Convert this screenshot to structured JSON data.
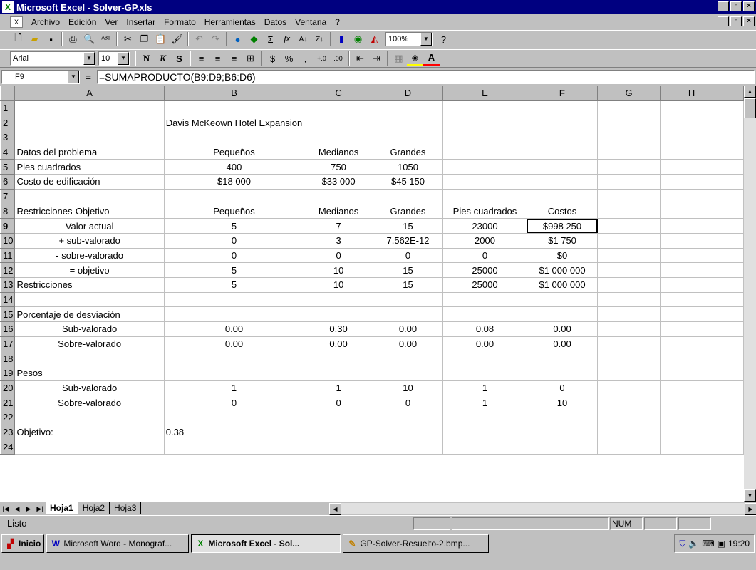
{
  "window": {
    "title": "Microsoft Excel - Solver-GP.xls"
  },
  "menu": [
    "Archivo",
    "Edición",
    "Ver",
    "Insertar",
    "Formato",
    "Herramientas",
    "Datos",
    "Ventana",
    "?"
  ],
  "toolbar": {
    "zoom": "100%",
    "font": "Arial",
    "font_size": "10",
    "bold": "N",
    "italic": "K",
    "underline": "S"
  },
  "formula_bar": {
    "name_box": "F9",
    "equals": "=",
    "formula": "=SUMAPRODUCTO(B9:D9;B6:D6)"
  },
  "sheet": {
    "columns": [
      "A",
      "B",
      "C",
      "D",
      "E",
      "F",
      "G",
      "H"
    ],
    "rows": [
      {
        "n": "1",
        "cells": [
          "",
          "",
          "",
          "",
          "",
          "",
          "",
          ""
        ]
      },
      {
        "n": "2",
        "cells": [
          "",
          "Davis McKeown Hotel Expansion",
          "",
          "",
          "",
          "",
          "",
          ""
        ]
      },
      {
        "n": "3",
        "cells": [
          "",
          "",
          "",
          "",
          "",
          "",
          "",
          ""
        ]
      },
      {
        "n": "4",
        "cells": [
          "Datos del problema",
          "Pequeños",
          "Medianos",
          "Grandes",
          "",
          "",
          "",
          ""
        ]
      },
      {
        "n": "5",
        "cells": [
          "Pies cuadrados",
          "400",
          "750",
          "1050",
          "",
          "",
          "",
          ""
        ]
      },
      {
        "n": "6",
        "cells": [
          "Costo de edificación",
          "$18 000",
          "$33 000",
          "$45 150",
          "",
          "",
          "",
          ""
        ]
      },
      {
        "n": "7",
        "cells": [
          "",
          "",
          "",
          "",
          "",
          "",
          "",
          ""
        ]
      },
      {
        "n": "8",
        "cells": [
          "Restricciones-Objetivo",
          "Pequeños",
          "Medianos",
          "Grandes",
          "Pies cuadrados",
          "Costos",
          "",
          ""
        ]
      },
      {
        "n": "9",
        "cells": [
          "Valor actual",
          "5",
          "7",
          "15",
          "23000",
          "$998 250",
          "",
          ""
        ]
      },
      {
        "n": "10",
        "cells": [
          "+ sub-valorado",
          "0",
          "3",
          "7.562E-12",
          "2000",
          "$1 750",
          "",
          ""
        ]
      },
      {
        "n": "11",
        "cells": [
          "- sobre-valorado",
          "0",
          "0",
          "0",
          "0",
          "$0",
          "",
          ""
        ]
      },
      {
        "n": "12",
        "cells": [
          "= objetivo",
          "5",
          "10",
          "15",
          "25000",
          "$1 000 000",
          "",
          ""
        ]
      },
      {
        "n": "13",
        "cells": [
          "Restricciones",
          "5",
          "10",
          "15",
          "25000",
          "$1 000 000",
          "",
          ""
        ]
      },
      {
        "n": "14",
        "cells": [
          "",
          "",
          "",
          "",
          "",
          "",
          "",
          ""
        ]
      },
      {
        "n": "15",
        "cells": [
          "Porcentaje de desviación",
          "",
          "",
          "",
          "",
          "",
          "",
          ""
        ]
      },
      {
        "n": "16",
        "cells": [
          "Sub-valorado",
          "0.00",
          "0.30",
          "0.00",
          "0.08",
          "0.00",
          "",
          ""
        ]
      },
      {
        "n": "17",
        "cells": [
          "Sobre-valorado",
          "0.00",
          "0.00",
          "0.00",
          "0.00",
          "0.00",
          "",
          ""
        ]
      },
      {
        "n": "18",
        "cells": [
          "",
          "",
          "",
          "",
          "",
          "",
          "",
          ""
        ]
      },
      {
        "n": "19",
        "cells": [
          "Pesos",
          "",
          "",
          "",
          "",
          "",
          "",
          ""
        ]
      },
      {
        "n": "20",
        "cells": [
          "Sub-valorado",
          "1",
          "1",
          "10",
          "1",
          "0",
          "",
          ""
        ]
      },
      {
        "n": "21",
        "cells": [
          "Sobre-valorado",
          "0",
          "0",
          "0",
          "1",
          "10",
          "",
          ""
        ]
      },
      {
        "n": "22",
        "cells": [
          "",
          "",
          "",
          "",
          "",
          "",
          "",
          ""
        ]
      },
      {
        "n": "23",
        "cells": [
          "Objetivo:",
          "0.38",
          "",
          "",
          "",
          "",
          "",
          ""
        ]
      },
      {
        "n": "24",
        "cells": [
          "",
          "",
          "",
          "",
          "",
          "",
          "",
          ""
        ]
      }
    ]
  },
  "tabs": [
    "Hoja1",
    "Hoja2",
    "Hoja3"
  ],
  "status": {
    "text": "Listo",
    "num": "NUM"
  },
  "taskbar": {
    "start": "Inicio",
    "items": [
      "Microsoft Word - Monograf...",
      "Microsoft Excel - Sol...",
      "GP-Solver-Resuelto-2.bmp..."
    ],
    "clock": "19:20"
  }
}
